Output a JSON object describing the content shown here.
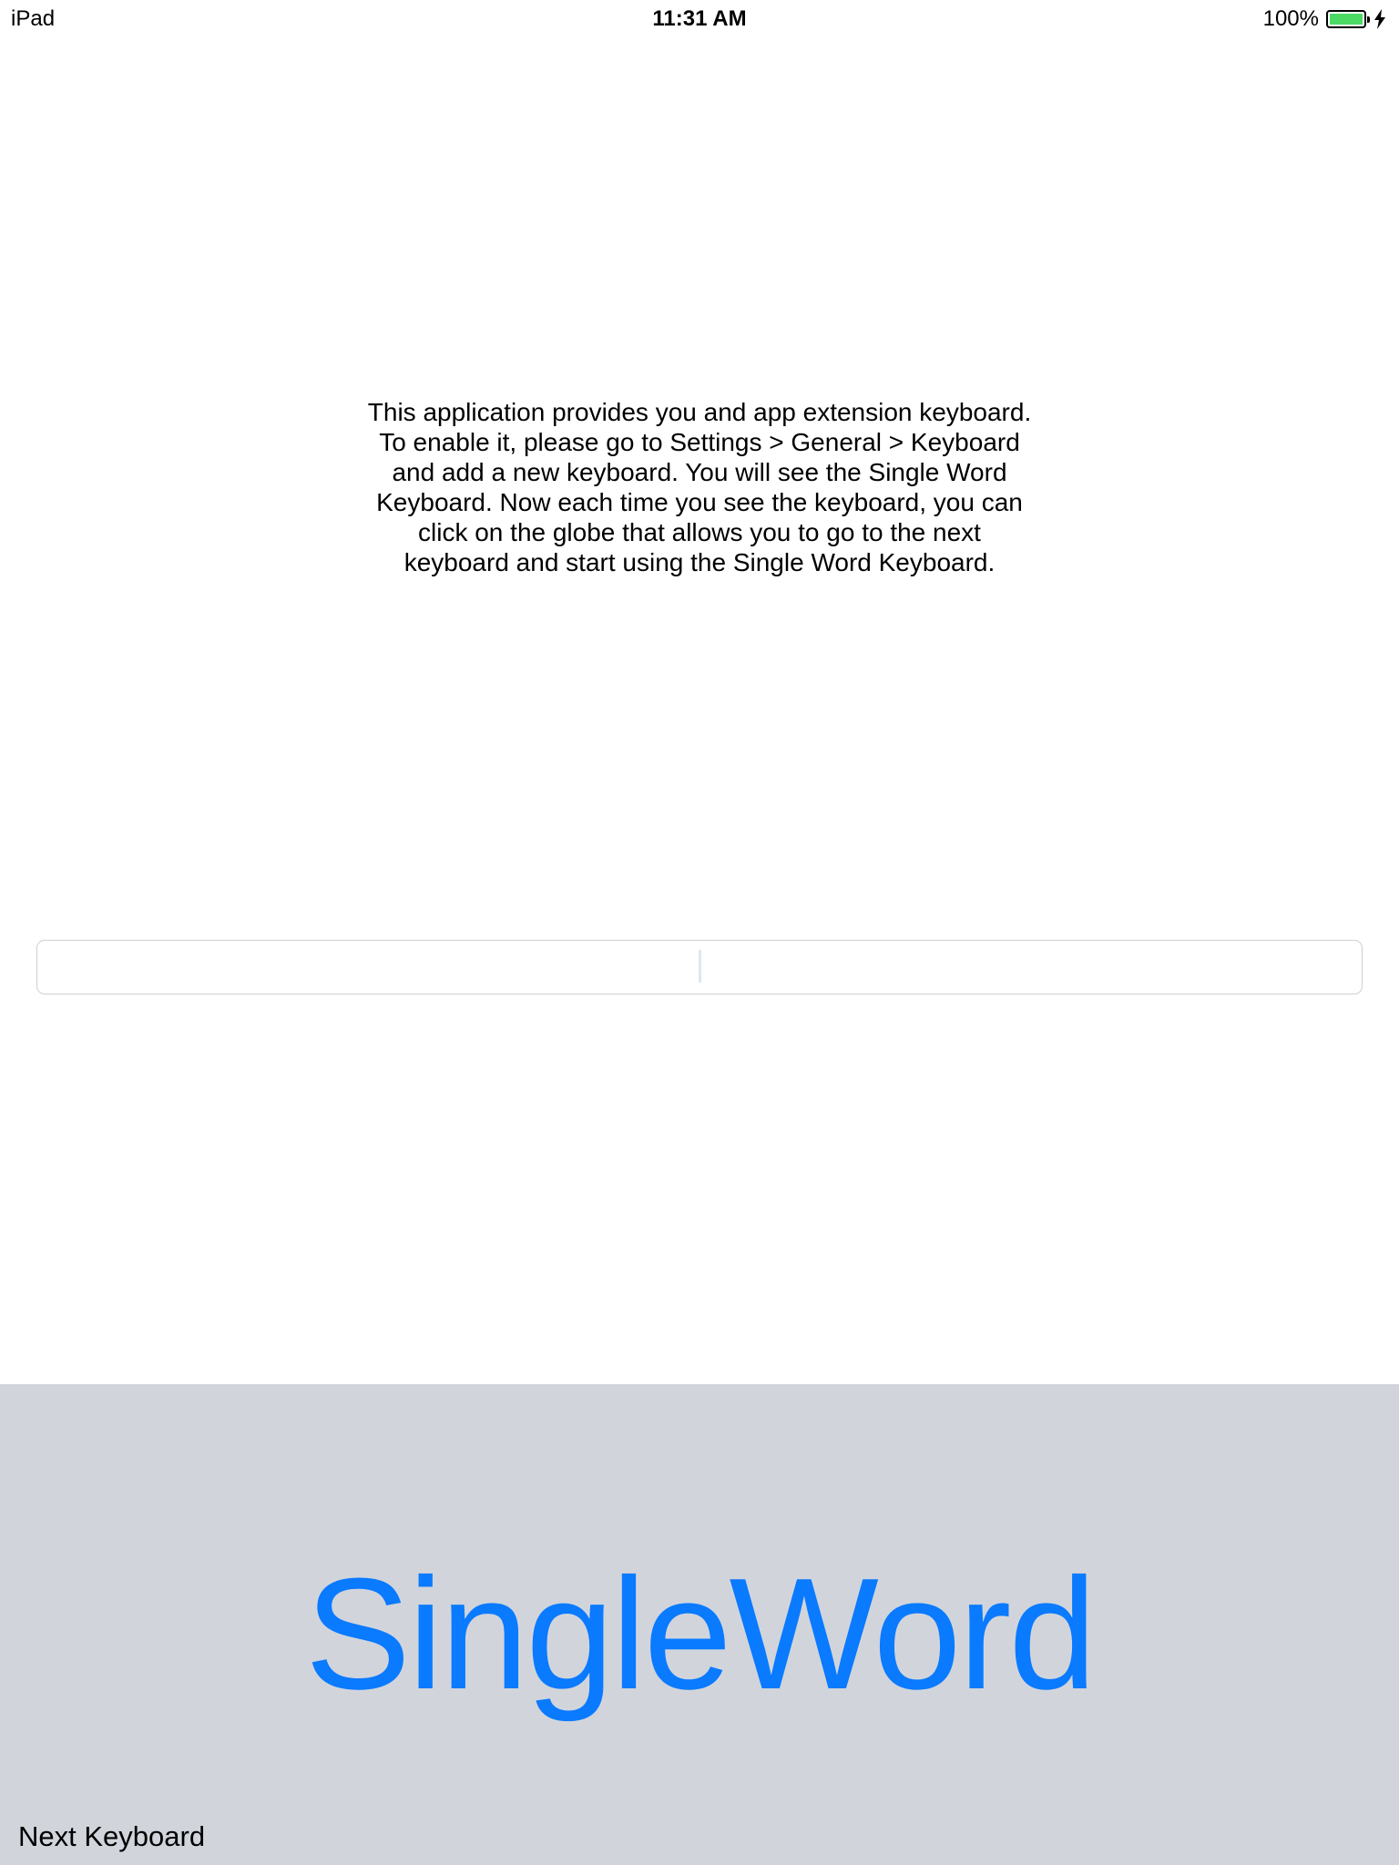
{
  "status_bar": {
    "device": "iPad",
    "time": "11:31 AM",
    "battery_percent": "100%",
    "battery_level": 1.0,
    "battery_color": "#4cd964",
    "battery_icon": "battery-full-icon",
    "charging_icon": "charging-bolt-icon"
  },
  "main": {
    "instructions_lines": [
      "This application provides you and app extension keyboard.",
      "To enable it, please go to Settings > General > Keyboard",
      "and add a new keyboard. You will see the Single Word",
      "Keyboard. Now each time you see the keyboard, you can",
      "click on the globe that allows you to go to the next",
      "keyboard and start using the Single Word Keyboard."
    ],
    "text_field": {
      "value": "",
      "placeholder": ""
    }
  },
  "keyboard": {
    "background_color": "#d1d5db",
    "word": "SingleWord",
    "word_color": "#0a7aff",
    "next_keyboard_label": "Next Keyboard"
  }
}
